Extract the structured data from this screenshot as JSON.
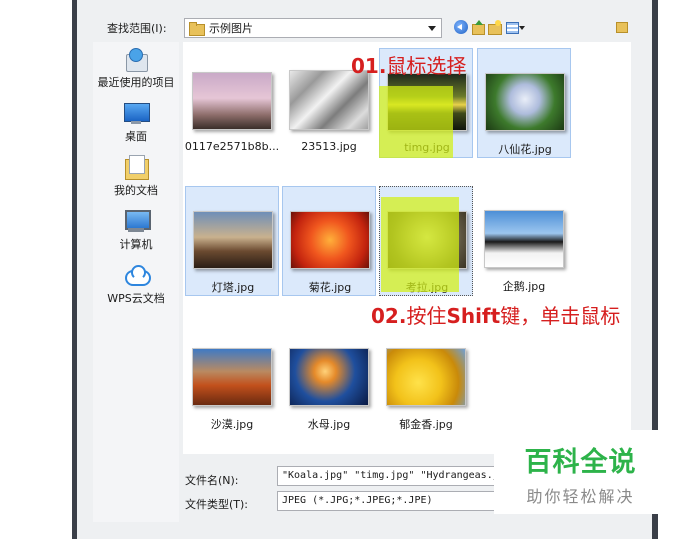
{
  "lookin": {
    "label": "查找范围(I):",
    "value": "示例图片"
  },
  "places": [
    {
      "label": "最近使用的项目",
      "icon": "recent-items-icon"
    },
    {
      "label": "桌面",
      "icon": "desktop-icon"
    },
    {
      "label": "我的文档",
      "icon": "my-documents-icon"
    },
    {
      "label": "计算机",
      "icon": "computer-icon"
    },
    {
      "label": "WPS云文档",
      "icon": "wps-cloud-icon"
    }
  ],
  "files": [
    {
      "name": "0117e2571b8b...",
      "selected": false
    },
    {
      "name": "23513.jpg",
      "selected": false
    },
    {
      "name": "timg.jpg",
      "selected": true
    },
    {
      "name": "八仙花.jpg",
      "selected": true
    },
    {
      "name": "灯塔.jpg",
      "selected": true
    },
    {
      "name": "菊花.jpg",
      "selected": true
    },
    {
      "name": "考拉.jpg",
      "selected": true
    },
    {
      "name": "企鹅.jpg",
      "selected": false
    },
    {
      "name": "沙漠.jpg",
      "selected": false
    },
    {
      "name": "水母.jpg",
      "selected": false
    },
    {
      "name": "郁金香.jpg",
      "selected": false
    }
  ],
  "annotations": {
    "step1_num": "01.",
    "step1_text": "鼠标选择",
    "step2_num": "02.",
    "step2_pre": "按住",
    "step2_key": "Shift",
    "step2_post": "键，单击鼠标",
    "color": "#d61f1f"
  },
  "filename": {
    "label": "文件名(N):",
    "value": "\"Koala.jpg\" \"timg.jpg\" \"Hydrangeas.j"
  },
  "filetype": {
    "label": "文件类型(T):",
    "value": "JPEG (*.JPG;*.JPEG;*.JPE)"
  },
  "watermark": {
    "title": "百科全说",
    "subtitle": "助你轻松解决",
    "color": "#2db34a"
  }
}
